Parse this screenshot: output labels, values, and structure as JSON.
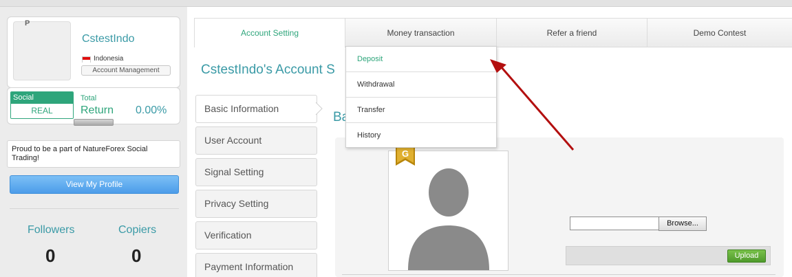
{
  "sidebar": {
    "avatar_letter": "P",
    "username": "CstestIndo",
    "country": "Indonesia",
    "account_management": "Account Management",
    "social_label": "Social",
    "account_type": "REAL",
    "total_label": "Total",
    "return_label": "Return",
    "return_value": "0.00%",
    "tagline": "Proud to be a part of NatureForex Social Trading!",
    "view_profile": "View My Profile",
    "followers_label": "Followers",
    "followers_value": "0",
    "copiers_label": "Copiers",
    "copiers_value": "0"
  },
  "tabs": [
    {
      "label": "Account Setting"
    },
    {
      "label": "Money transaction"
    },
    {
      "label": "Refer a friend"
    },
    {
      "label": "Demo Contest"
    }
  ],
  "dropdown": {
    "items": [
      {
        "label": "Deposit"
      },
      {
        "label": "Withdrawal"
      },
      {
        "label": "Transfer"
      },
      {
        "label": "History"
      }
    ]
  },
  "main": {
    "page_title": "CstestIndo's Account S",
    "section_title": "Ba",
    "badge_letter": "G",
    "browse_label": "Browse...",
    "upload_label": "Upload",
    "nav": [
      {
        "label": "Basic Information"
      },
      {
        "label": "User Account"
      },
      {
        "label": "Signal Setting"
      },
      {
        "label": "Privacy Setting"
      },
      {
        "label": "Verification"
      },
      {
        "label": "Payment Information"
      }
    ]
  },
  "colors": {
    "accent_teal": "#3a9aa6",
    "accent_green": "#2ea57b",
    "button_blue": "#4c9ce9",
    "upload_green": "#5aa832",
    "annotation_red": "#b30f0f"
  }
}
